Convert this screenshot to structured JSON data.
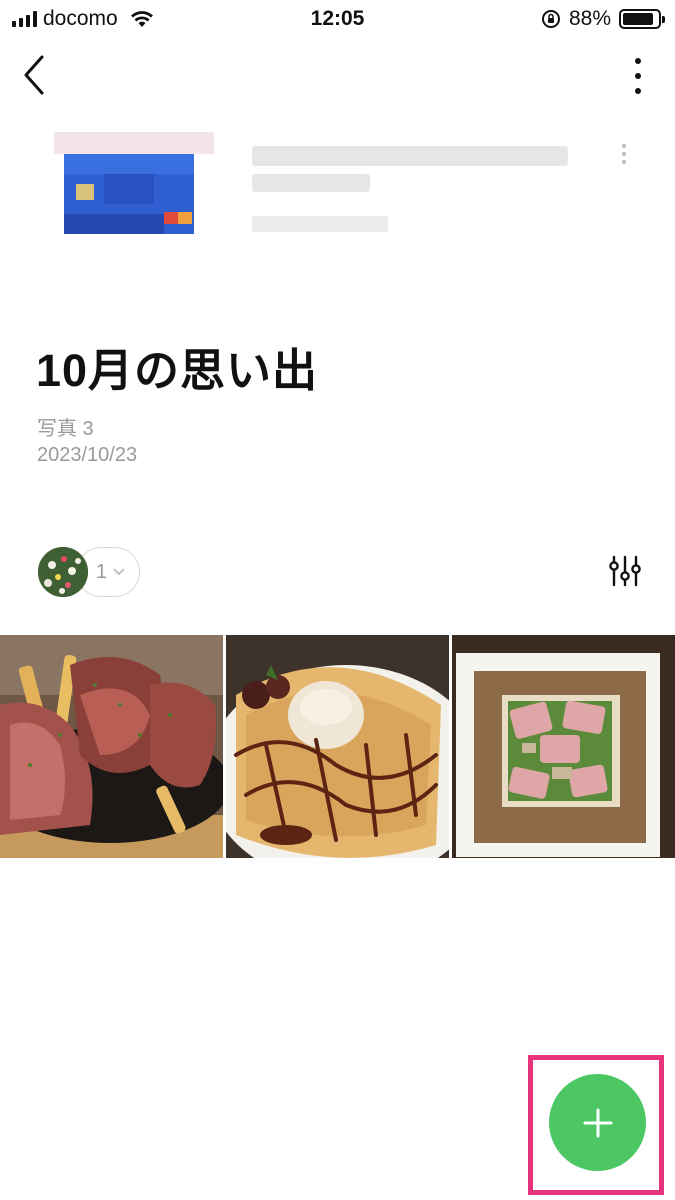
{
  "status_bar": {
    "carrier": "docomo",
    "time": "12:05",
    "battery_percent": "88%",
    "battery_level": 0.88
  },
  "nav": {
    "back_icon": "chevron-left-icon",
    "more_icon": "more-vertical-icon"
  },
  "album": {
    "title": "10月の思い出",
    "photo_count": "写真 3",
    "date": "2023/10/23"
  },
  "members": {
    "count": "1"
  },
  "photos": [
    {
      "subject": "steak with fries"
    },
    {
      "subject": "crepe with ice cream and chocolate sauce"
    },
    {
      "subject": "galette with ham and salad"
    }
  ],
  "fab": {
    "icon": "plus-icon",
    "color": "#4cc764",
    "highlight_color": "#e5337c"
  }
}
